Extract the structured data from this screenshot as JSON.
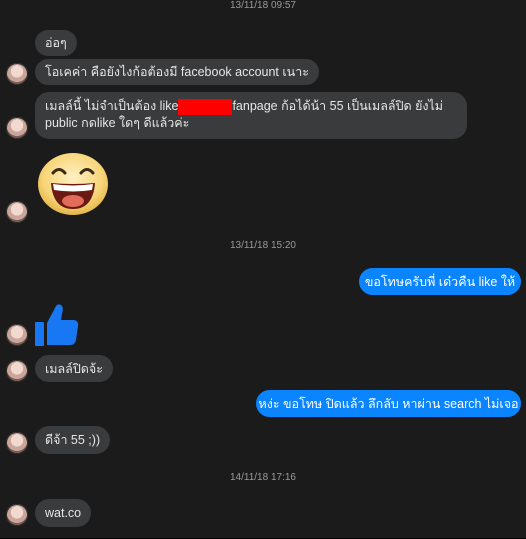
{
  "timestamps": [
    "13/11/18 09:57",
    "13/11/18 15:20",
    "14/11/18 17:16"
  ],
  "messages": {
    "m1": "อ่อๆ",
    "m2": "โอเคค่า คือยังไงก้อต้องมี facebook account เนาะ",
    "m3": {
      "line1_a": "เมลล์นี้ ไม่จำเป็นต้อง like",
      "line1_b": "fanpage ก้อได้น้า 55 เป็นเมลล์ปิด ยังไม่",
      "line2": "public กดlike ใดๆ ดีแล้วค่ะ"
    },
    "m4": "ขอโทษครับพี่ เด๋วคืน like ให้",
    "m5": "เมลล์ปิดจ้ะ",
    "m6": "หง่ะ ขอโทษ ปิดแล้ว ลึกลับ หาผ่าน search ไม่เจอ",
    "m7": "ดีจ้า 55 ;))",
    "m8": "wat.co"
  },
  "icons": {
    "emoji": "laughing-face",
    "like": "thumbs-up"
  },
  "colors": {
    "background": "#1b1b1c",
    "incoming_bubble": "#3a3b3c",
    "outgoing_bubble": "#0a84ff",
    "like_blue": "#1877f2",
    "redaction": "#ff0000"
  }
}
